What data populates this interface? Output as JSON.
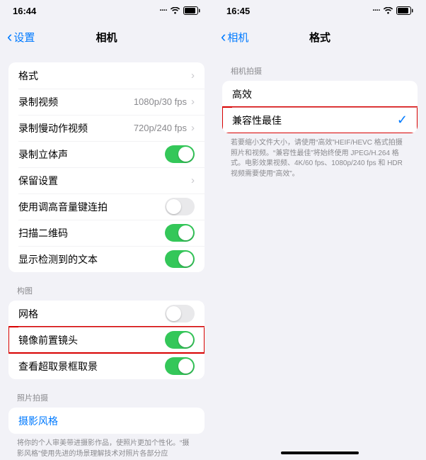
{
  "left": {
    "status_time": "16:44",
    "back_label": "设置",
    "title": "相机",
    "rows": {
      "format": "格式",
      "record_video": "录制视频",
      "record_video_val": "1080p/30 fps",
      "record_slomo": "录制慢动作视频",
      "record_slomo_val": "720p/240 fps",
      "stereo": "录制立体声",
      "preserve": "保留设置",
      "volume_burst": "使用调高音量键连拍",
      "scan_qr": "扫描二维码",
      "detect_text": "显示检测到的文本"
    },
    "composition_header": "构图",
    "grid": "网格",
    "mirror_front": "镜像前置镜头",
    "view_outside": "查看超取景框取景",
    "photo_header": "照片拍摄",
    "photo_styles": "摄影风格",
    "photo_footer": "将你的个人审美带进摄影作品，使照片更加个性化。“摄影风格”使用先进的场景理解技术对照片各部分应"
  },
  "right": {
    "status_time": "16:45",
    "back_label": "相机",
    "title": "格式",
    "section_header": "相机拍摄",
    "high_eff": "高效",
    "most_compat": "兼容性最佳",
    "footer": "若要缩小文件大小，请使用“高效”HEIF/HEVC 格式拍摄照片和视频。“兼容性最佳”将始终使用 JPEG/H.264 格式。电影效果视频、4K/60 fps、1080p/240 fps 和 HDR 视频需要使用“高效”。"
  }
}
